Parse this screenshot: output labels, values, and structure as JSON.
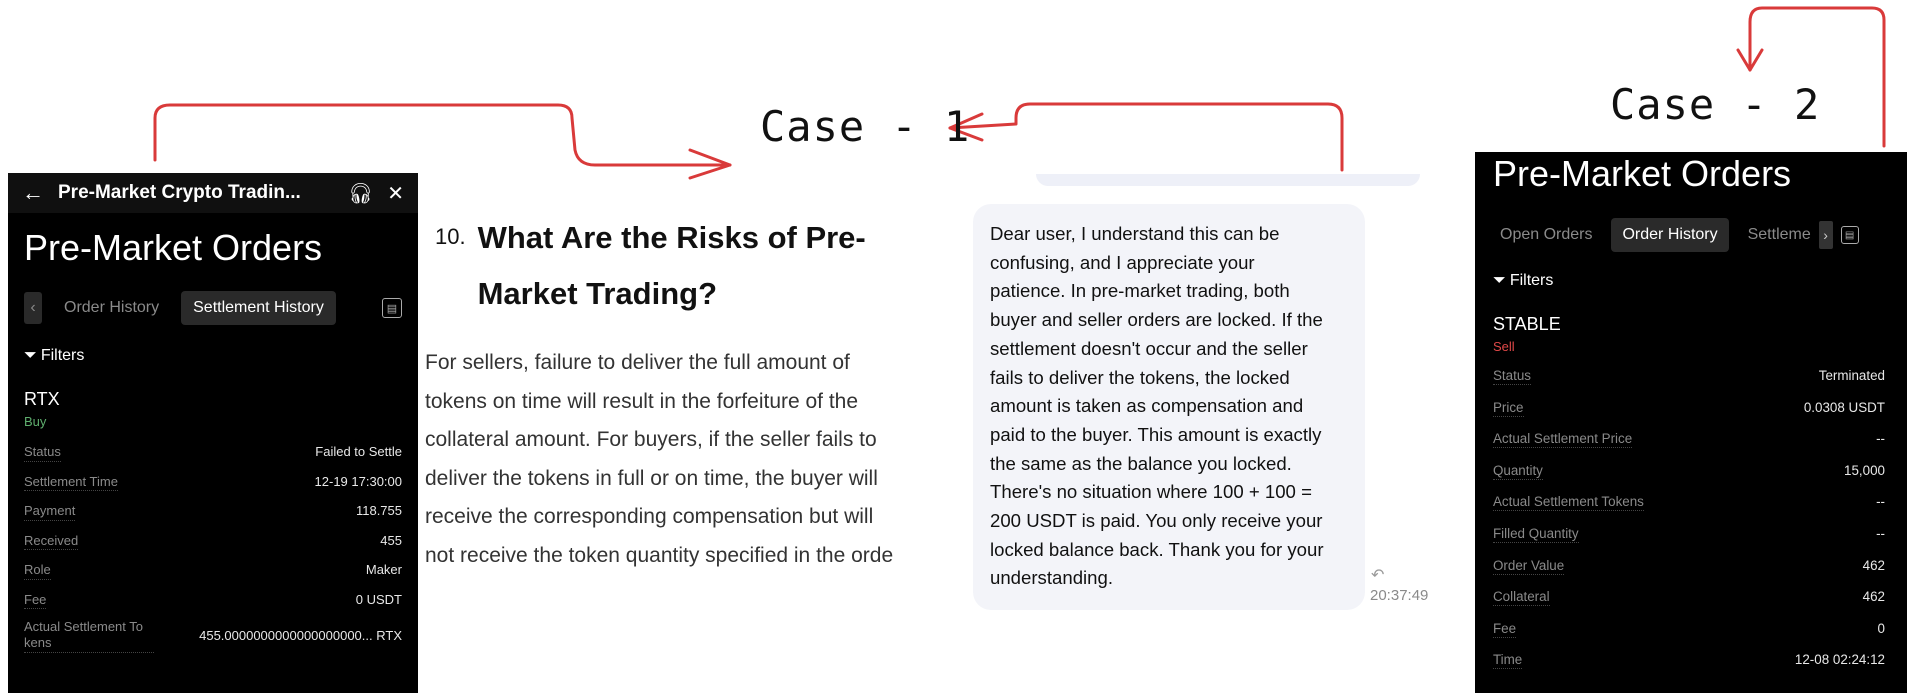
{
  "annotations": {
    "case1": "Case - 1",
    "case2": "Case - 2",
    "arrow_color": "#d93a3a"
  },
  "left_panel": {
    "header_title": "Pre-Market Crypto Tradin...",
    "page_title": "Pre-Market Orders",
    "tabs": [
      "Order History",
      "Settlement History"
    ],
    "active_tab": "Settlement History",
    "filters_label": "Filters",
    "asset": "RTX",
    "side": "Buy",
    "side_color": "#5fae6e",
    "rows": [
      {
        "label": "Status",
        "value": "Failed to Settle"
      },
      {
        "label": "Settlement Time",
        "value": "12-19 17:30:00"
      },
      {
        "label": "Payment",
        "value": "118.755"
      },
      {
        "label": "Received",
        "value": "455"
      },
      {
        "label": "Role",
        "value": "Maker"
      },
      {
        "label": "Fee",
        "value": "0 USDT"
      },
      {
        "label": "Actual Settlement To kens",
        "value": "455.0000000000000000000... RTX"
      }
    ]
  },
  "article": {
    "number": "10.",
    "title_line1": "What Are the Risks of Pre-",
    "title_line2": "Market Trading?",
    "body_lines": [
      "For sellers, failure to deliver the full amount of",
      "tokens on time will result in the forfeiture of the",
      "collateral amount. For buyers, if the seller fails to",
      "deliver the tokens in full or on time, the buyer will",
      "receive the corresponding compensation but will",
      "not receive the token quantity specified in the orde"
    ]
  },
  "chat": {
    "message_lines": [
      "Dear user, I understand this can be",
      "confusing, and I appreciate your",
      "patience. In pre-market trading, both",
      "buyer and seller orders are locked. If the",
      "settlement doesn't occur and the seller",
      "fails to deliver the tokens, the locked",
      "amount is taken as compensation and",
      "paid to the buyer. This amount is exactly",
      "the same as the balance you locked.",
      "There's no situation where 100 + 100 =",
      "200 USDT is paid. You only receive your",
      "locked balance back. Thank you for your",
      "understanding."
    ],
    "time": "20:37:49"
  },
  "right_panel": {
    "page_title": "Pre-Market Orders",
    "tabs": [
      "Open Orders",
      "Order History",
      "Settleme"
    ],
    "active_tab": "Order History",
    "filters_label": "Filters",
    "asset": "STABLE",
    "side": "Sell",
    "side_color": "#e04848",
    "rows": [
      {
        "label": "Status",
        "value": "Terminated"
      },
      {
        "label": "Price",
        "value": "0.0308 USDT"
      },
      {
        "label": "Actual Settlement Price",
        "value": "--"
      },
      {
        "label": "Quantity",
        "value": "15,000"
      },
      {
        "label": "Actual Settlement Tokens",
        "value": "--"
      },
      {
        "label": "Filled Quantity",
        "value": "--"
      },
      {
        "label": "Order Value",
        "value": "462"
      },
      {
        "label": "Collateral",
        "value": "462"
      },
      {
        "label": "Fee",
        "value": "0"
      },
      {
        "label": "Time",
        "value": "12-08 02:24:12"
      }
    ]
  }
}
